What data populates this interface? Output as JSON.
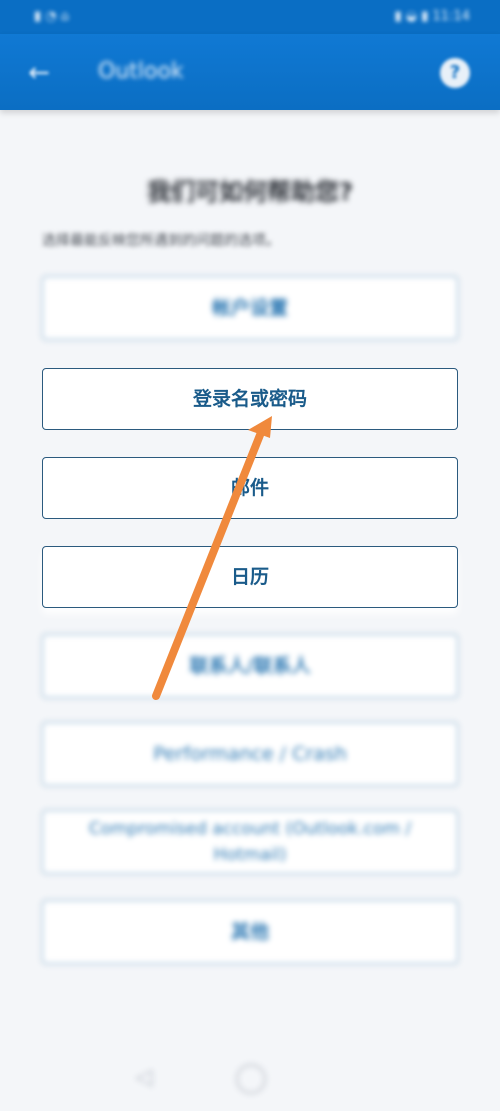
{
  "status_bar": {
    "left_text": "▮ ◔ ⌂",
    "right_text": "▮ ◒ ▮ 11:14"
  },
  "app_bar": {
    "back_icon": "arrow-left-icon",
    "title": "Outlook",
    "help_icon": "help-icon",
    "help_glyph": "?"
  },
  "content": {
    "heading": "我们可如何帮助您?",
    "subtext": "选择最能反映您所遇到的问题的选项。",
    "options": [
      "帐户设置",
      "登录名或密码",
      "邮件",
      "日历",
      "联系人/联系人",
      "Performance / Crash",
      "Compromised account (Outlook.com / Hotmail)",
      "其他"
    ]
  },
  "annotation": {
    "arrow_color": "#f0893c"
  },
  "colors": {
    "app_bar": "#0b6ec3",
    "option_text": "#1a5b8a",
    "option_border": "#2b5a7e",
    "background": "#f4f6f9"
  }
}
